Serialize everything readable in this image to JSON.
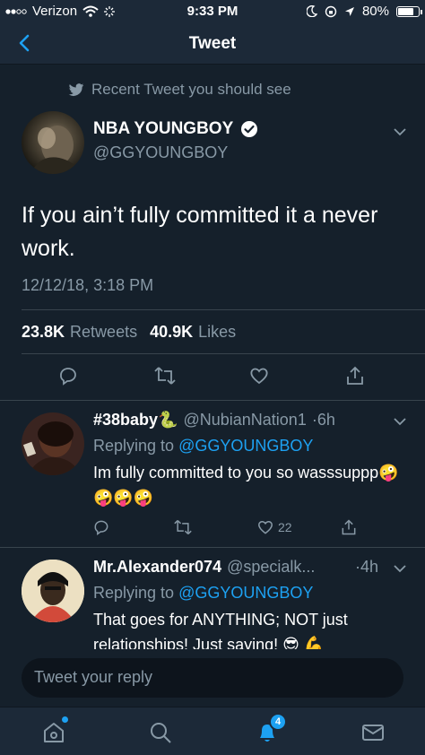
{
  "status_bar": {
    "carrier": "Verizon",
    "time": "9:33 PM",
    "battery": "80%",
    "battery_level": 0.8
  },
  "nav": {
    "title": "Tweet",
    "back_icon": "chevron-left-icon"
  },
  "recommendation": {
    "label": "Recent Tweet you should see",
    "icon": "twitter-bird-icon"
  },
  "main_tweet": {
    "name": "NBA YOUNGBOY",
    "handle": "@GGYOUNGBOY",
    "text": "If you ain’t fully committed it a never work.",
    "date": "12/12/18, 3:18 PM",
    "retweets_count": "23.8K",
    "retweets_label": "Retweets",
    "likes_count": "40.9K",
    "likes_label": "Likes"
  },
  "replies": [
    {
      "name": "#38baby🐍",
      "handle": "@NubianNation1",
      "time": "·6h",
      "replying_label": "Replying to",
      "replying_to": "@GGYOUNGBOY",
      "text": "Im fully committed to you so wasssuppp🤪🤪🤪🤪",
      "likes": "22"
    },
    {
      "name": "Mr.Alexander074",
      "handle": "@specialk...",
      "time": "·4h",
      "replying_label": "Replying to",
      "replying_to": "@GGYOUNGBOY",
      "text": "That goes for ANYTHING; NOT just relationships! Just saying! 😎 💪"
    }
  ],
  "composer": {
    "placeholder": "Tweet your reply"
  },
  "tab_bar": {
    "notifications_badge": "4"
  },
  "colors": {
    "background": "#15202b",
    "bar": "#1c2938",
    "accent": "#1da1f2",
    "muted": "#8899a6"
  }
}
